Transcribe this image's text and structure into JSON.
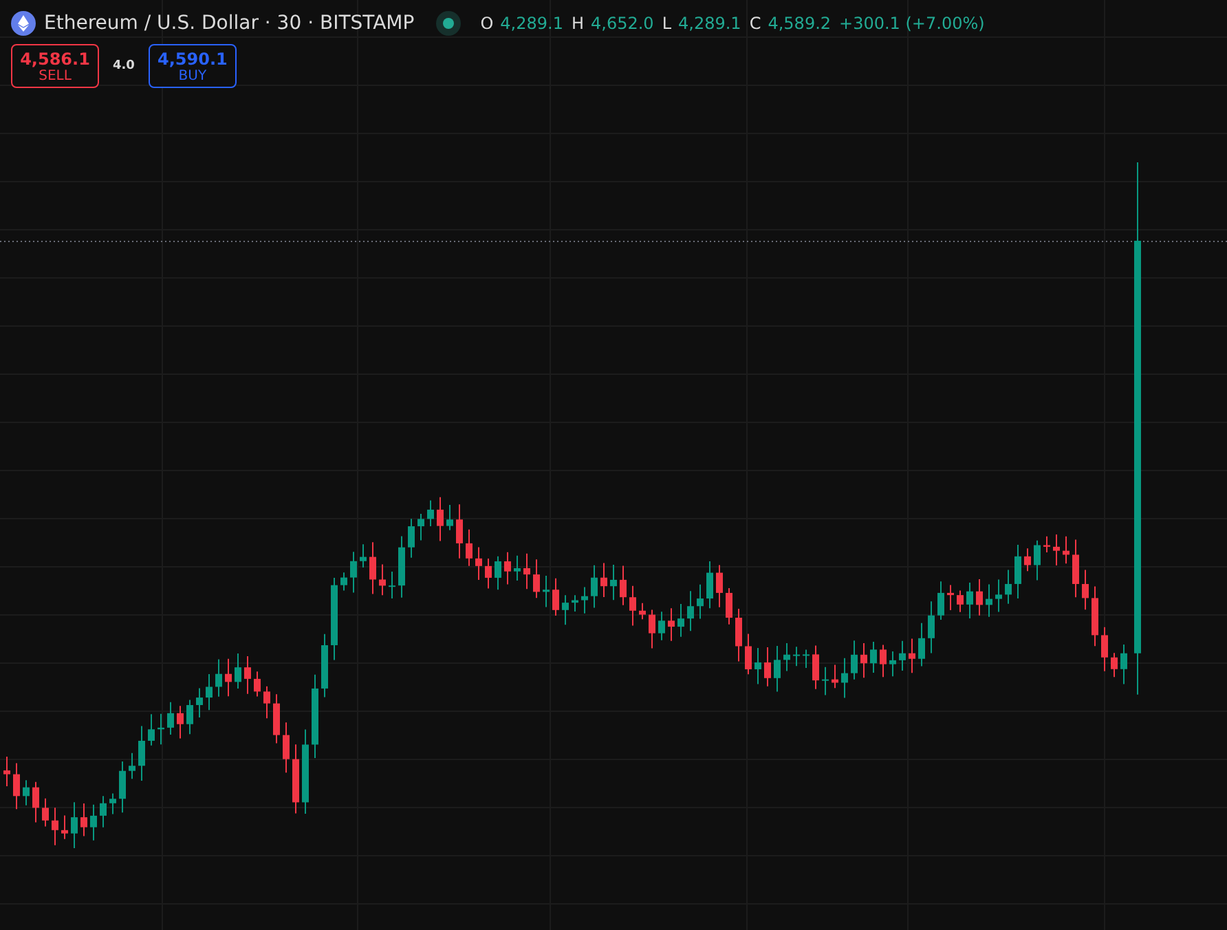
{
  "legend": {
    "title": "Ethereum / U.S. Dollar · 30 · BITSTAMP",
    "ohlc": [
      {
        "label": "O",
        "value": "4,289.1"
      },
      {
        "label": "H",
        "value": "4,652.0"
      },
      {
        "label": "L",
        "value": "4,289.1"
      },
      {
        "label": "C",
        "value": "4,589.2"
      }
    ],
    "change": "+300.1 (+7.00%)"
  },
  "trade": {
    "sell": {
      "price": "4,586.1",
      "label": "SELL"
    },
    "spread": "4.0",
    "buy": {
      "price": "4,590.1",
      "label": "BUY"
    }
  }
}
